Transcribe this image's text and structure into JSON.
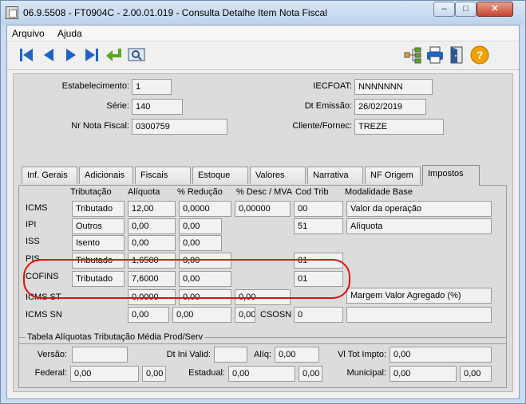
{
  "window": {
    "title": "06.9.5508 - FT0904C - 2.00.01.019 - Consulta Detalhe Item Nota Fiscal"
  },
  "menu": {
    "items": [
      "Arquivo",
      "Ajuda"
    ]
  },
  "header": {
    "estabelecimento_label": "Estabelecimento:",
    "estabelecimento": "1",
    "serie_label": "Série:",
    "serie": "140",
    "nr_nota_label": "Nr Nota Fiscal:",
    "nr_nota": "0300759",
    "iecfoat_label": "IECFOAT:",
    "iecfoat": "NNNNNNN",
    "dt_emissao_label": "Dt Emissão:",
    "dt_emissao": "26/02/2019",
    "cliente_label": "Cliente/Fornec:",
    "cliente": "TREZE"
  },
  "tabs": [
    "Inf. Gerais",
    "Adicionais",
    "Fiscais",
    "Estoque",
    "Valores",
    "Narrativa",
    "NF Origem",
    "Impostos"
  ],
  "columns": [
    "Tributação",
    "Alíquota",
    "% Redução",
    "% Desc / MVA",
    "Cod Trib",
    "Modalidade Base"
  ],
  "taxes": {
    "icms": {
      "label": "ICMS",
      "trib": "Tributado",
      "aliq": "12,00",
      "red": "0,0000",
      "desc": "0,00000",
      "cod": "00",
      "mod": "Valor da operação"
    },
    "ipi": {
      "label": "IPI",
      "trib": "Outros",
      "aliq": "0,00",
      "red": "0,00",
      "cod": "51",
      "mod": "Alíquota"
    },
    "iss": {
      "label": "ISS",
      "trib": "Isento",
      "aliq": "0,00",
      "red": "0,00"
    },
    "pis": {
      "label": "PIS",
      "trib": "Tributado",
      "aliq": "1,6500",
      "red": "0,00",
      "cod": "01"
    },
    "cofins": {
      "label": "COFINS",
      "trib": "Tributado",
      "aliq": "7,6000",
      "red": "0,00",
      "cod": "01"
    },
    "icmsst": {
      "label": "ICMS ST",
      "aliq": "0,0000",
      "red": "0,00",
      "desc": "0,00",
      "mod": "Margem Valor Agregado (%)"
    },
    "icmssn": {
      "label": "ICMS SN",
      "v1": "0,00",
      "v2": "0,00",
      "v3": "0,00",
      "csosn_label": "CSOSN",
      "csosn": "0"
    }
  },
  "group": {
    "title": "Tabela Alíquotas Tributação Média Prod/Serv",
    "versao_label": "Versão:",
    "versao": "",
    "dt_ini_label": "Dt Ini Valid:",
    "dt_ini": "",
    "aliq_label": "Alíq:",
    "aliq": "0,00",
    "vl_tot_label": "Vl Tot Impto:",
    "vl_tot": "0,00",
    "federal_label": "Federal:",
    "federal1": "0,00",
    "federal2": "0,00",
    "estadual_label": "Estadual:",
    "estadual1": "0,00",
    "estadual2": "0,00",
    "municipal_label": "Municipal:",
    "municipal1": "0,00",
    "municipal2": "0,00"
  },
  "colors": {
    "highlight": "#e01010",
    "accent": "#1c64c8"
  }
}
